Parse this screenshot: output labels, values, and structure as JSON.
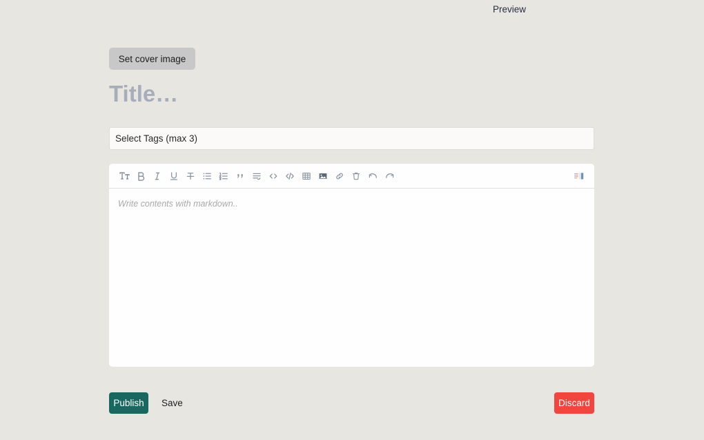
{
  "page": {
    "background_color": "#E8E6E1"
  },
  "topbar": {
    "preview_label": "Preview"
  },
  "cover": {
    "button_label": "Set cover image",
    "button_color": "#C8C8C8"
  },
  "title": {
    "value": "",
    "placeholder": "Title…",
    "placeholder_color": "#A7AEBA"
  },
  "tags": {
    "value": "",
    "placeholder": "Select Tags (max 3)"
  },
  "editor": {
    "placeholder": "Write contents with markdown..",
    "content": "",
    "toolbar": {
      "items": [
        {
          "name": "heading-icon",
          "label": "TT"
        },
        {
          "name": "bold-icon",
          "label": "B"
        },
        {
          "name": "italic-icon",
          "label": "I"
        },
        {
          "name": "underline-icon",
          "label": "U"
        },
        {
          "name": "strikethrough-icon",
          "label": "S"
        },
        {
          "name": "bullet-list-icon",
          "label": "Bulleted list"
        },
        {
          "name": "numbered-list-icon",
          "label": "Numbered list"
        },
        {
          "name": "blockquote-icon",
          "label": "Quote"
        },
        {
          "name": "indent-icon",
          "label": "Indent"
        },
        {
          "name": "inline-code-icon",
          "label": "<>"
        },
        {
          "name": "code-block-icon",
          "label": "</>"
        },
        {
          "name": "table-icon",
          "label": "Table"
        },
        {
          "name": "image-icon",
          "label": "Image"
        },
        {
          "name": "link-icon",
          "label": "Link"
        },
        {
          "name": "trash-icon",
          "label": "Delete"
        },
        {
          "name": "undo-icon",
          "label": "Undo"
        },
        {
          "name": "redo-icon",
          "label": "Redo"
        }
      ],
      "split_view": {
        "name": "split-view-icon",
        "label": "Split view"
      }
    }
  },
  "footer": {
    "publish_label": "Publish",
    "publish_color": "#19685F",
    "save_label": "Save",
    "discard_label": "Discard",
    "discard_color": "#F2453D"
  }
}
